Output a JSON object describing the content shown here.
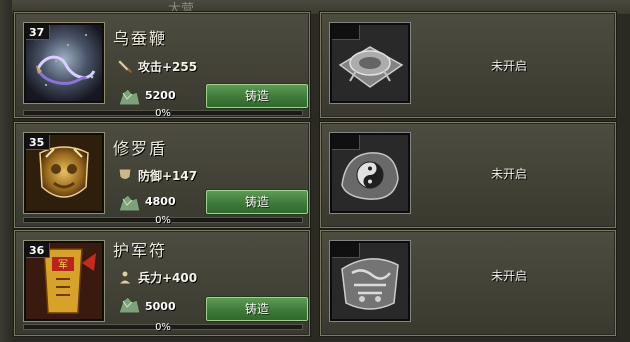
{
  "background_hint": "大营",
  "equipment": [
    {
      "level": "37",
      "name": "乌蚕鞭",
      "stat_icon": "sword-icon",
      "stat": "攻击+255",
      "cost": "5200",
      "button": "铸造",
      "progress": 0,
      "progress_label": "0%"
    },
    {
      "level": "35",
      "name": "修罗盾",
      "stat_icon": "shield-icon",
      "stat": "防御+147",
      "cost": "4800",
      "button": "铸造",
      "progress": 0,
      "progress_label": "0%"
    },
    {
      "level": "36",
      "name": "护军符",
      "stat_icon": "soldier-icon",
      "stat": "兵力+400",
      "cost": "5000",
      "button": "铸造",
      "progress": 0,
      "progress_label": "0%"
    }
  ],
  "locked_slots": [
    {
      "item_icon": "compass-icon",
      "label": "未开启"
    },
    {
      "item_icon": "yin-yang-icon",
      "label": "未开启"
    },
    {
      "item_icon": "token-icon",
      "label": "未开启"
    }
  ],
  "colors": {
    "button_green": "#3f7a3a",
    "panel": "#46453a",
    "border": "#7b7964"
  }
}
